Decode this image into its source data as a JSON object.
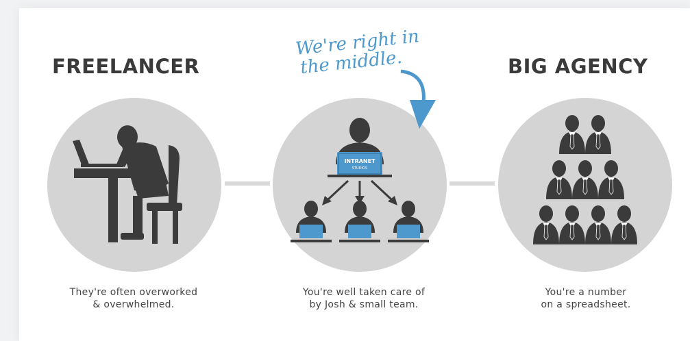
{
  "columns": [
    {
      "heading": "FREELANCER",
      "caption_line1": "They're often overworked",
      "caption_line2": "& overwhelmed."
    },
    {
      "callout_line1": "We're right in",
      "callout_line2": "the middle.",
      "laptop_logo_line1": "INTRANET",
      "laptop_logo_line2": "STUDIOS",
      "caption_line1": "You're well taken care of",
      "caption_line2": "by Josh & small team."
    },
    {
      "heading": "BIG AGENCY",
      "caption_line1": "You're a number",
      "caption_line2": "on a spreadsheet."
    }
  ],
  "colors": {
    "circle": "#d4d4d4",
    "figure": "#3b3b3b",
    "accent_blue": "#4d98cc",
    "heading": "#3a3a3a",
    "connector": "#d9d9d9"
  }
}
